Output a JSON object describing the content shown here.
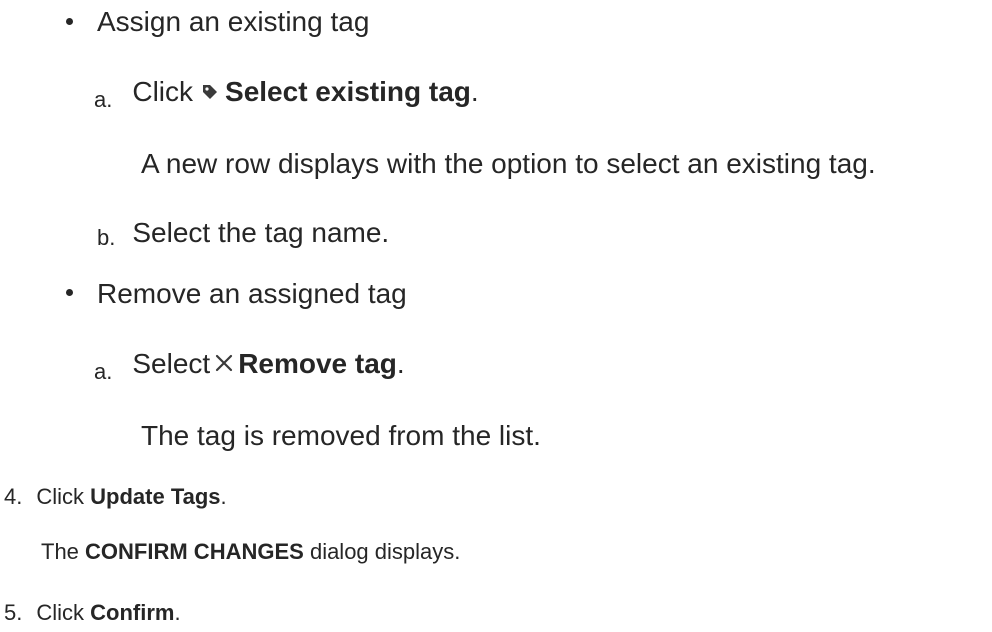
{
  "assign": {
    "bullet_text": "Assign an existing tag",
    "step_a": {
      "marker": "a.",
      "prefix": "Click",
      "action": "Select existing tag",
      "suffix": ".",
      "icon": "tag-icon",
      "result": "A new row displays with the option to select an existing tag."
    },
    "step_b": {
      "marker": "b.",
      "text": "Select the tag name."
    }
  },
  "remove": {
    "bullet_text": "Remove an assigned tag",
    "step_a": {
      "marker": "a.",
      "prefix": "Select",
      "action": "Remove tag",
      "suffix": ".",
      "icon": "close-x-icon",
      "result": "The tag is removed from the list."
    }
  },
  "step4": {
    "number": "4.",
    "prefix": "Click",
    "action": "Update Tags",
    "suffix": ".",
    "result_dialog": "CONFIRM CHANGES",
    "result_rest": "dialog displays.",
    "result_prefix": "The"
  },
  "step5": {
    "number": "5.",
    "prefix": "Click",
    "action": "Confirm",
    "suffix": "."
  },
  "colors": {
    "text": "#262626",
    "icon": "#3a3a3a"
  }
}
